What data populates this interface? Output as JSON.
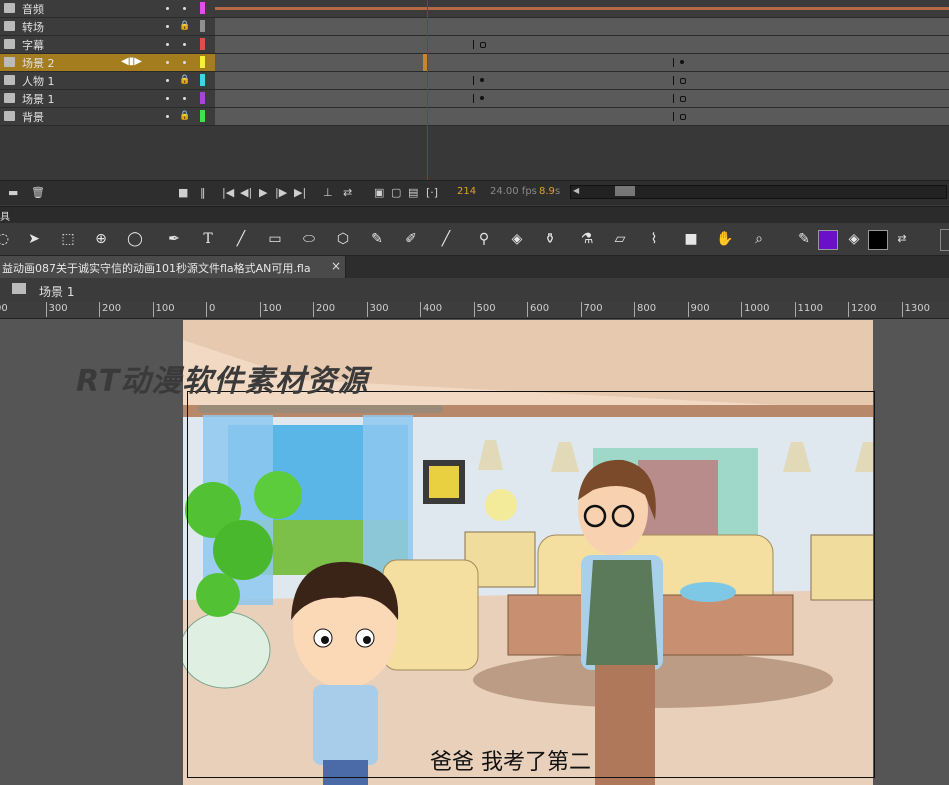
{
  "timeline": {
    "layers": [
      {
        "name": "音频",
        "color": "#e34ee6",
        "locked": false,
        "active": false
      },
      {
        "name": "转场",
        "color": "#8f8f8f",
        "locked": true,
        "active": false
      },
      {
        "name": "字幕",
        "color": "#e34c4c",
        "locked": false,
        "active": false
      },
      {
        "name": "场景 2",
        "color": "#f5ee3a",
        "locked": false,
        "active": true
      },
      {
        "name": "人物 1",
        "color": "#39d6e6",
        "locked": true,
        "active": false
      },
      {
        "name": "场景 1",
        "color": "#a447d8",
        "locked": false,
        "active": false
      },
      {
        "name": "背景",
        "color": "#3de34a",
        "locked": true,
        "active": false
      }
    ],
    "current_frame": "214",
    "fps": "24.00 fps",
    "time": "8.9",
    "time_unit": "s",
    "playhead_color": "#c02020"
  },
  "tools": {
    "panel_label": "具",
    "stroke_color": "#6a10c8",
    "fill_color": "#000000"
  },
  "document": {
    "tab_label": "益动画087关于诚实守信的动画101秒源文件fla格式AN可用.fla",
    "close_label": "×",
    "scene_label": "场景 1"
  },
  "ruler": {
    "ticks": [
      "00",
      "300",
      "200",
      "100",
      "0",
      "100",
      "200",
      "300",
      "400",
      "500",
      "600",
      "700",
      "800",
      "900",
      "1000",
      "1100",
      "1200",
      "1300"
    ]
  },
  "stage": {
    "watermark": "RT动漫软件素材资源",
    "subtitle": "爸爸 我考了第二"
  }
}
